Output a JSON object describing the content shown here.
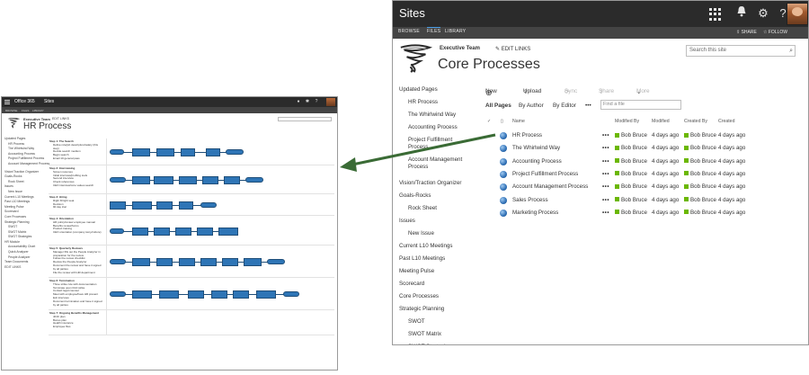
{
  "small": {
    "suite": {
      "app": "Office 365",
      "sites": "Sites"
    },
    "ribbon": [
      "BROWSE",
      "FILES",
      "LIBRARY"
    ],
    "team": "Executive Team",
    "edit_links": "EDIT LINKS",
    "title": "HR Process",
    "nav": [
      {
        "label": "Updated Pages",
        "indent": false
      },
      {
        "label": "HR Process",
        "indent": true
      },
      {
        "label": "The Whirlwind Way",
        "indent": true
      },
      {
        "label": "Accounting Process",
        "indent": true
      },
      {
        "label": "Project Fulfillment Process",
        "indent": true
      },
      {
        "label": "Account Management Process",
        "indent": true
      },
      {
        "label": "",
        "indent": false
      },
      {
        "label": "Vision/Traction Organizer",
        "indent": false
      },
      {
        "label": "Goals-Rocks",
        "indent": false
      },
      {
        "label": "Rock Sheet",
        "indent": true
      },
      {
        "label": "Issues",
        "indent": false
      },
      {
        "label": "New Issue",
        "indent": true
      },
      {
        "label": "Current L10 Meetings",
        "indent": false
      },
      {
        "label": "Past L10 Meetings",
        "indent": false
      },
      {
        "label": "Meeting Pulse",
        "indent": false
      },
      {
        "label": "Scorecard",
        "indent": false
      },
      {
        "label": "Core Processes",
        "indent": false
      },
      {
        "label": "Strategic Planning",
        "indent": false
      },
      {
        "label": "SWOT",
        "indent": true
      },
      {
        "label": "SWOT Matrix",
        "indent": true
      },
      {
        "label": "SWOT Strategies",
        "indent": true
      },
      {
        "label": "HR Module",
        "indent": false
      },
      {
        "label": "Accountability Chart",
        "indent": true
      },
      {
        "label": "Quick Analyzer",
        "indent": true
      },
      {
        "label": "People Analyzer",
        "indent": true
      },
      {
        "label": "Team Documents",
        "indent": false
      },
      {
        "label": "EDIT LINKS",
        "indent": false
      }
    ],
    "steps": [
      {
        "title": "Step 1: The Search",
        "bullets": [
          "Define role/job description/salary (this step)",
          "Decide search medium",
          "Begin search",
          "Email 10 general pass"
        ]
      },
      {
        "title": "Step 2: Interviewing",
        "bullets": [
          "Screen resumes",
          "Initial interview/profiling tools",
          "Second interview",
          "Check references",
          "CEO interview/core values search"
        ]
      },
      {
        "title": "Step 3: Hiring",
        "bullets": [
          "Right fit/right seat",
          "Decision",
          "90 day trial"
        ]
      },
      {
        "title": "Step 4: Orientation",
        "bullets": [
          "HR policy/review employee manual",
          "Benefits review/forms",
          "Product training",
          "CEO orientation (company story/culture)"
        ]
      },
      {
        "title": "Step 5: Quarterly Reviews",
        "bullets": [
          "Manager fills out the People Analyzer in preparation for the review",
          "Follow the review checklist",
          "Review the People Analyzer",
          "Document the review and have it signed by all parties",
          "File the review with HR department"
        ]
      },
      {
        "title": "Step 6: Termination",
        "bullets": [
          "Three strike rule with documentation",
          "Terminate upon third strike",
          "Contact legal counsel",
          "Meet with employee/have HR present",
          "Exit interview",
          "Document termination and have it signed by all parties"
        ]
      },
      {
        "title": "Step 7: Ongoing Benefits Management",
        "bullets": [
          "401K plan",
          "Bonus plan",
          "Health insurance",
          "Employee files"
        ]
      }
    ]
  },
  "big": {
    "suite": {
      "sites": "Sites"
    },
    "ribbon": {
      "tabs": [
        "BROWSE",
        "FILES",
        "LIBRARY"
      ],
      "share": "SHARE",
      "follow": "FOLLOW"
    },
    "team": "Executive Team",
    "edit_links": "EDIT LINKS",
    "title": "Core Processes",
    "search_placeholder": "Search this site",
    "nav": [
      {
        "label": "Updated Pages",
        "indent": false
      },
      {
        "label": "HR Process",
        "indent": true
      },
      {
        "label": "The Whirlwind Way",
        "indent": true
      },
      {
        "label": "Accounting Process",
        "indent": true
      },
      {
        "label": "Project Fulfillment Process",
        "indent": true,
        "wrap": true
      },
      {
        "label": "Account Management Process",
        "indent": true,
        "wrap": true
      },
      {
        "label": "Vision/Traction Organizer",
        "indent": false
      },
      {
        "label": "Goals-Rocks",
        "indent": false
      },
      {
        "label": "Rock Sheet",
        "indent": true
      },
      {
        "label": "Issues",
        "indent": false
      },
      {
        "label": "New Issue",
        "indent": true
      },
      {
        "label": "Current L10 Meetings",
        "indent": false
      },
      {
        "label": "Past L10 Meetings",
        "indent": false
      },
      {
        "label": "Meeting Pulse",
        "indent": false
      },
      {
        "label": "Scorecard",
        "indent": false
      },
      {
        "label": "Core Processes",
        "indent": false
      },
      {
        "label": "Strategic Planning",
        "indent": false
      },
      {
        "label": "SWOT",
        "indent": true
      },
      {
        "label": "SWOT Matrix",
        "indent": true
      },
      {
        "label": "SWOT Strategies",
        "indent": true
      }
    ],
    "toolbar": {
      "new": "New",
      "upload": "Upload",
      "sync": "Sync",
      "share": "Share",
      "more": "More"
    },
    "views": {
      "all_pages": "All Pages",
      "by_author": "By Author",
      "by_editor": "By Editor",
      "more": "•••"
    },
    "find_placeholder": "Find a file",
    "columns": {
      "name": "Name",
      "modified_by": "Modified By",
      "modified": "Modified",
      "created_by": "Created By",
      "created": "Created"
    },
    "files": [
      {
        "name": "HR Process",
        "modified_by": "Bob Bruce",
        "modified": "4 days ago",
        "created_by": "Bob Bruce",
        "created": "4 days ago"
      },
      {
        "name": "The Whirlwind Way",
        "modified_by": "Bob Bruce",
        "modified": "4 days ago",
        "created_by": "Bob Bruce",
        "created": "4 days ago"
      },
      {
        "name": "Accounting Process",
        "modified_by": "Bob Bruce",
        "modified": "4 days ago",
        "created_by": "Bob Bruce",
        "created": "4 days ago"
      },
      {
        "name": "Project Fulfillment Process",
        "modified_by": "Bob Bruce",
        "modified": "4 days ago",
        "created_by": "Bob Bruce",
        "created": "4 days ago"
      },
      {
        "name": "Account Management Process",
        "modified_by": "Bob Bruce",
        "modified": "4 days ago",
        "created_by": "Bob Bruce",
        "created": "4 days ago"
      },
      {
        "name": "Sales Process",
        "modified_by": "Bob Bruce",
        "modified": "4 days ago",
        "created_by": "Bob Bruce",
        "created": "4 days ago"
      },
      {
        "name": "Marketing Process",
        "modified_by": "Bob Bruce",
        "modified": "4 days ago",
        "created_by": "Bob Bruce",
        "created": "4 days ago"
      }
    ]
  },
  "colors": {
    "suite_bar": "#2b2b2b",
    "ribbon": "#444444",
    "presence": "#6bb700",
    "arrow": "#3a6b35",
    "flow_node": "#2e75b6"
  }
}
